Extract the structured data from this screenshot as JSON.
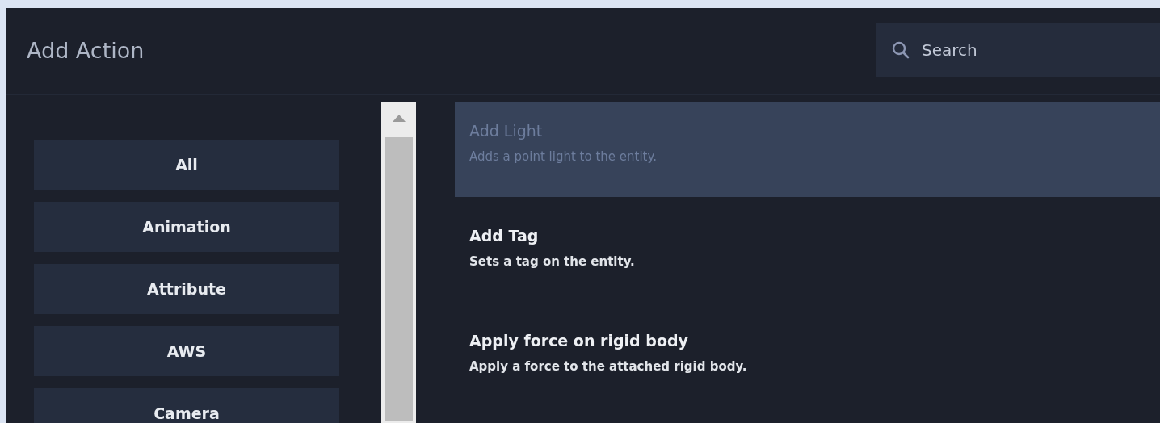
{
  "window": {
    "title": "Add Action"
  },
  "search": {
    "placeholder": "Search"
  },
  "categories": [
    {
      "label": "All",
      "selected": false
    },
    {
      "label": "Animation",
      "selected": false
    },
    {
      "label": "Attribute",
      "selected": false
    },
    {
      "label": "AWS",
      "selected": false
    },
    {
      "label": "Camera",
      "selected": false
    }
  ],
  "actions": [
    {
      "name": "Add Light",
      "description": "Adds a point light to the entity.",
      "selected": true
    },
    {
      "name": "Add Tag",
      "description": "Sets a tag on the entity.",
      "selected": false
    },
    {
      "name": "Apply force on rigid body",
      "description": "Apply a force to the attached rigid body.",
      "selected": false
    }
  ]
}
